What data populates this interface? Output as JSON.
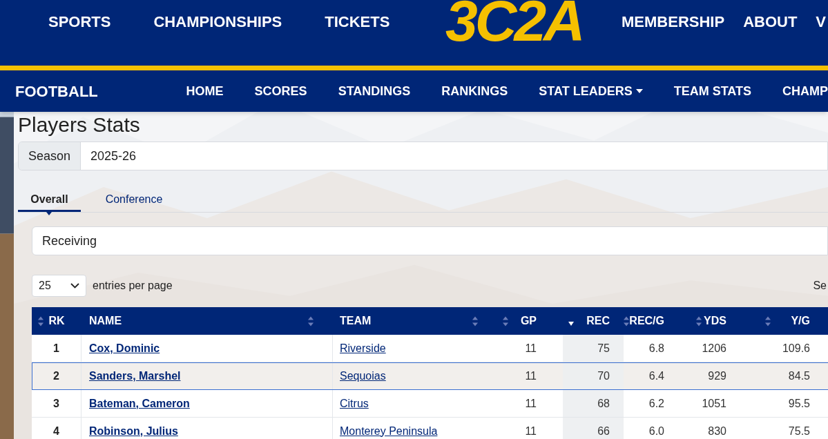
{
  "top_nav": {
    "left_items": [
      "SPORTS",
      "CHAMPIONSHIPS",
      "TICKETS"
    ],
    "logo": "3C2A",
    "right_items": [
      "MEMBERSHIP",
      "ABOUT",
      "V"
    ]
  },
  "sport_nav": {
    "title": "FOOTBALL",
    "items": [
      {
        "label": "HOME",
        "dropdown": false
      },
      {
        "label": "SCORES",
        "dropdown": false
      },
      {
        "label": "STANDINGS",
        "dropdown": false
      },
      {
        "label": "RANKINGS",
        "dropdown": false
      },
      {
        "label": "STAT LEADERS",
        "dropdown": true
      },
      {
        "label": "TEAM STATS",
        "dropdown": false
      },
      {
        "label": "CHAMP",
        "dropdown": false
      }
    ]
  },
  "page_title": "Players Stats",
  "season": {
    "label": "Season",
    "value": "2025-26"
  },
  "tabs": [
    {
      "label": "Overall",
      "selected": true
    },
    {
      "label": "Conference",
      "selected": false
    }
  ],
  "category": {
    "value": "Receiving"
  },
  "entries": {
    "value": "25",
    "label": "entries per page"
  },
  "search_label": "Se",
  "table": {
    "columns": [
      {
        "label": "RK",
        "sorted": false
      },
      {
        "label": "NAME",
        "sorted": false
      },
      {
        "label": "TEAM",
        "sorted": false
      },
      {
        "label": "GP",
        "sorted": false
      },
      {
        "label": "REC",
        "sorted": true
      },
      {
        "label": "REC/G",
        "sorted": false
      },
      {
        "label": "YDS",
        "sorted": false
      },
      {
        "label": "Y/G",
        "sorted": false
      }
    ],
    "rows": [
      {
        "selected": false,
        "cells": [
          "1",
          "Cox, Dominic",
          "Riverside",
          "11",
          "75",
          "6.8",
          "1206",
          "109.6"
        ]
      },
      {
        "selected": true,
        "cells": [
          "2",
          "Sanders, Marshel",
          "Sequoias",
          "11",
          "70",
          "6.4",
          "929",
          "84.5"
        ]
      },
      {
        "selected": false,
        "cells": [
          "3",
          "Bateman, Cameron",
          "Citrus",
          "11",
          "68",
          "6.2",
          "1051",
          "95.5"
        ]
      },
      {
        "selected": false,
        "cells": [
          "4",
          "Robinson, Julius",
          "Monterey Peninsula",
          "11",
          "66",
          "6.0",
          "830",
          "75.5"
        ]
      }
    ]
  }
}
